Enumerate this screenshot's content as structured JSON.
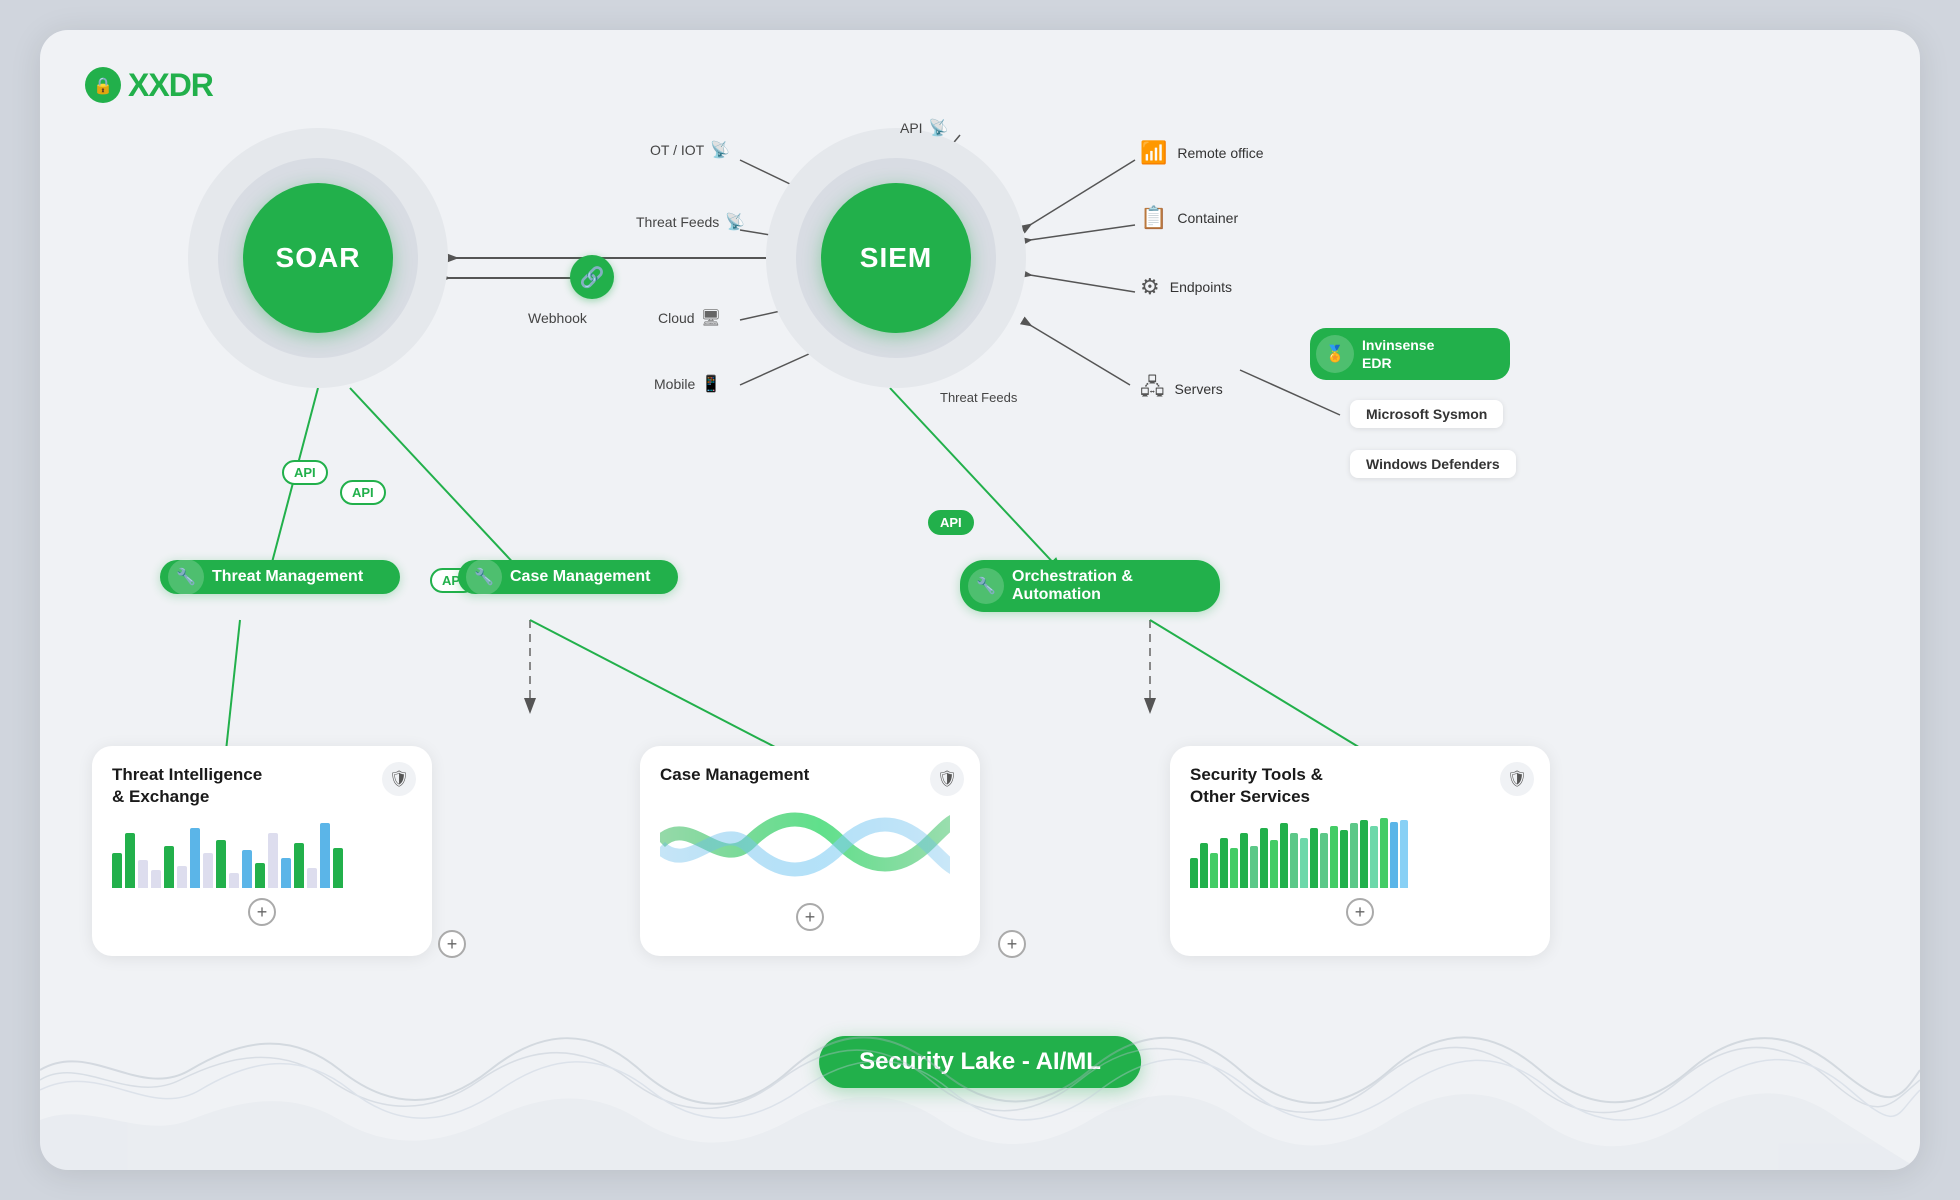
{
  "logo": {
    "icon": "🔒",
    "text_pre": "X",
    "text_brand": "XDR"
  },
  "nodes": {
    "soar": {
      "label": "SOAR"
    },
    "siem": {
      "label": "SIEM"
    }
  },
  "badges": {
    "api1": "API",
    "api2": "API",
    "api3": "API",
    "api4": "API",
    "api5": "API"
  },
  "pills": {
    "threat_management": "Threat Management",
    "case_management": "Case Management",
    "orchestration": "Orchestration &\nAutomation"
  },
  "sources": {
    "ot_iot": "OT / IOT",
    "threat_feeds_top": "Threat Feeds",
    "cloud": "Cloud",
    "mobile": "Mobile",
    "threat_feeds_bottom": "Threat Feeds",
    "webhook": "Webhook",
    "api_top": "API"
  },
  "right_tools": {
    "remote_office": "Remote office",
    "container": "Container",
    "endpoints": "Endpoints",
    "servers": "Servers"
  },
  "edr": {
    "label": "Invinsense\nEDR"
  },
  "other_tools": {
    "microsoft": "Microsoft Sysmon",
    "windows": "Windows Defenders"
  },
  "bottom_cards": {
    "threat_intel": {
      "title": "Threat Intelligence\n& Exchange",
      "icon": "🛡"
    },
    "case_mgmt": {
      "title": "Case Management",
      "icon": "🛡"
    },
    "security_tools": {
      "title": "Security Tools &\nOther Services",
      "icon": "🛡"
    }
  },
  "security_lake": "Security Lake - AI/ML",
  "plus_buttons": [
    "+",
    "+",
    "+",
    "+",
    "+"
  ]
}
